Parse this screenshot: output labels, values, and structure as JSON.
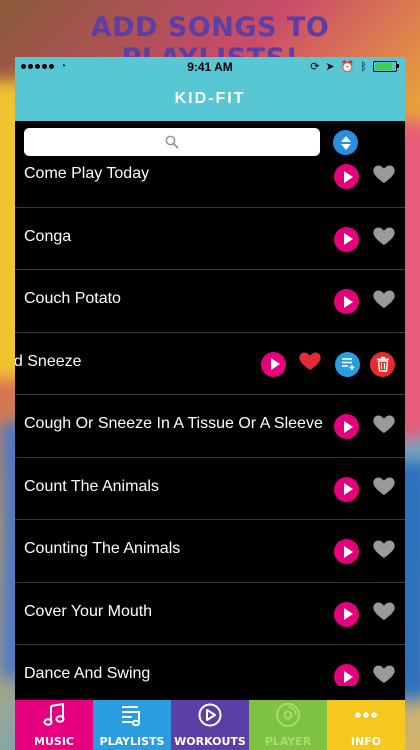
{
  "headline": "ADD SONGS TO PLAYLISTS!",
  "status_bar": {
    "time": "9:41 AM"
  },
  "nav": {
    "title": "KID-FIT"
  },
  "search": {
    "placeholder": ""
  },
  "songs": [
    {
      "title": "Come Play Today",
      "favorite": false
    },
    {
      "title": "Conga",
      "favorite": false
    },
    {
      "title": "Couch Potato",
      "favorite": false
    },
    {
      "title": "nd Sneeze",
      "favorite": true,
      "swiped": true
    },
    {
      "title": "Cough Or Sneeze In A Tissue Or A Sleeve",
      "favorite": false
    },
    {
      "title": "Count The Animals",
      "favorite": false
    },
    {
      "title": "Counting The Animals",
      "favorite": false
    },
    {
      "title": "Cover Your Mouth",
      "favorite": false
    },
    {
      "title": "Dance And Swing",
      "favorite": false
    }
  ],
  "tabs": [
    {
      "label": "MUSIC",
      "icon": "music-note-icon"
    },
    {
      "label": "PLAYLISTS",
      "icon": "playlist-icon"
    },
    {
      "label": "WORKOUTS",
      "icon": "play-circle-icon"
    },
    {
      "label": "PLAYER",
      "icon": "disc-icon"
    },
    {
      "label": "INFO",
      "icon": "dots-icon"
    }
  ],
  "colors": {
    "nav": "#56c7d3",
    "play": "#e6007e",
    "favorite_on": "#e62a3a",
    "favorite_off": "#9a9a9a",
    "add_playlist": "#2a9de0",
    "delete": "#e82a2a"
  }
}
